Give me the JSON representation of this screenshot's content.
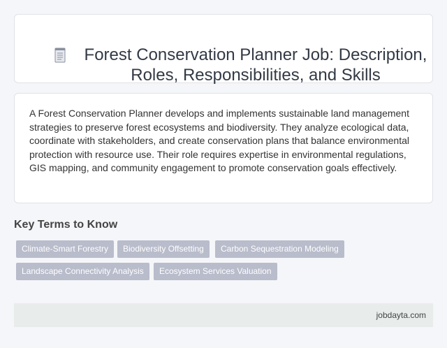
{
  "header": {
    "icon": "document-icon",
    "title": "Forest Conservation Planner Job: Description, Roles, Responsibilities, and Skills"
  },
  "description": {
    "text": "A Forest Conservation Planner develops and implements sustainable land management strategies to preserve forest ecosystems and biodiversity. They analyze ecological data, coordinate with stakeholders, and create conservation plans that balance environmental protection with resource use. Their role requires expertise in environmental regulations, GIS mapping, and community engagement to promote conservation goals effectively."
  },
  "key_terms": {
    "heading": "Key Terms to Know",
    "tags": [
      "Climate-Smart Forestry",
      "Biodiversity Offsetting",
      "Carbon Sequestration Modeling",
      "Landscape Connectivity Analysis",
      "Ecosystem Services Valuation"
    ]
  },
  "footer": {
    "site": "jobdayta.com"
  },
  "colors": {
    "background": "#f5f6f9",
    "card": "#ffffff",
    "tag": "#b8bccb",
    "footer": "#e8edec"
  }
}
